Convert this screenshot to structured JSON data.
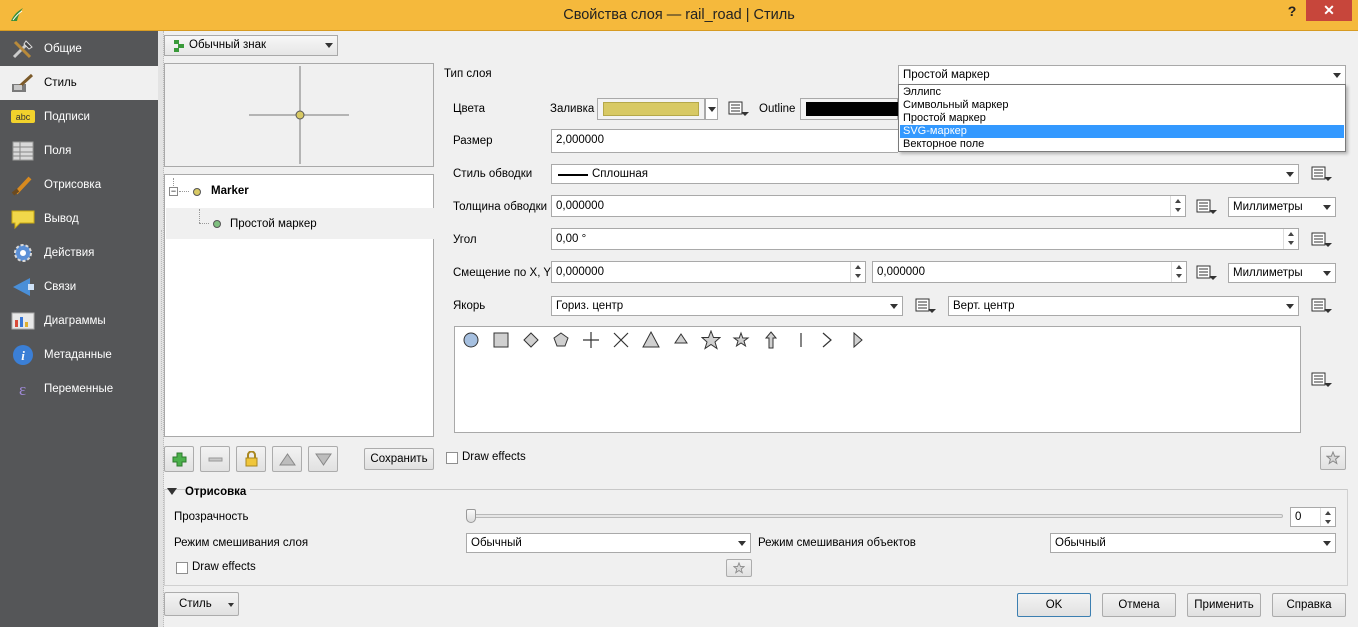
{
  "window": {
    "title": "Свойства слоя — rail_road | Стиль",
    "help_label": "?",
    "close_label": "✕"
  },
  "sidebar": {
    "items": [
      {
        "label": "Общие",
        "icon": "tools-icon"
      },
      {
        "label": "Стиль",
        "icon": "paintbrush-icon"
      },
      {
        "label": "Подписи",
        "icon": "abc-label-icon"
      },
      {
        "label": "Поля",
        "icon": "table-icon"
      },
      {
        "label": "Отрисовка",
        "icon": "brush-icon"
      },
      {
        "label": "Вывод",
        "icon": "speech-bubble-icon"
      },
      {
        "label": "Действия",
        "icon": "gear-icon"
      },
      {
        "label": "Связи",
        "icon": "join-icon"
      },
      {
        "label": "Диаграммы",
        "icon": "diagram-icon"
      },
      {
        "label": "Метаданные",
        "icon": "info-icon"
      },
      {
        "label": "Переменные",
        "icon": "epsilon-icon"
      }
    ]
  },
  "renderer": {
    "selected": "Обычный знак"
  },
  "tree": {
    "root_label": "Marker",
    "child_label": "Простой маркер"
  },
  "toolbar": {
    "save_label": "Сохранить"
  },
  "layer": {
    "type_label": "Тип слоя",
    "type_selected": "Простой маркер",
    "type_options": [
      "Эллипс",
      "Символьный маркер",
      "Простой маркер",
      "SVG-маркер",
      "Векторное поле"
    ],
    "type_highlighted": "SVG-маркер"
  },
  "props": {
    "colors_label": "Цвета",
    "fill_label": "Заливка",
    "fill_color": "#d8c964",
    "outline_label": "Outline",
    "outline_color": "#000000",
    "size_label": "Размер",
    "size_value": "2,000000",
    "stroke_style_label": "Стиль обводки",
    "stroke_style_value": "Сплошная",
    "stroke_width_label": "Толщина обводки",
    "stroke_width_value": "0,000000",
    "stroke_unit": "Миллиметры",
    "angle_label": "Угол",
    "angle_value": "0,00 °",
    "offset_label": "Смещение по X, Y",
    "offset_x": "0,000000",
    "offset_y": "0,000000",
    "offset_unit": "Миллиметры",
    "anchor_label": "Якорь",
    "anchor_h": "Гориз. центр",
    "anchor_v": "Верт. центр",
    "draw_effects_label": "Draw effects"
  },
  "rendering": {
    "section_label": "Отрисовка",
    "opacity_label": "Прозрачность",
    "opacity_value": "0",
    "layer_blend_label": "Режим смешивания слоя",
    "layer_blend_value": "Обычный",
    "feature_blend_label": "Режим смешивания объектов",
    "feature_blend_value": "Обычный",
    "draw_effects_label": "Draw effects"
  },
  "footer": {
    "style_label": "Стиль",
    "ok_label": "OK",
    "cancel_label": "Отмена",
    "apply_label": "Применить",
    "help_label": "Справка"
  },
  "colors": {
    "titlebar": "#f5b93c",
    "sidebar": "#555658",
    "highlight": "#3399ff",
    "close": "#c7463b"
  }
}
